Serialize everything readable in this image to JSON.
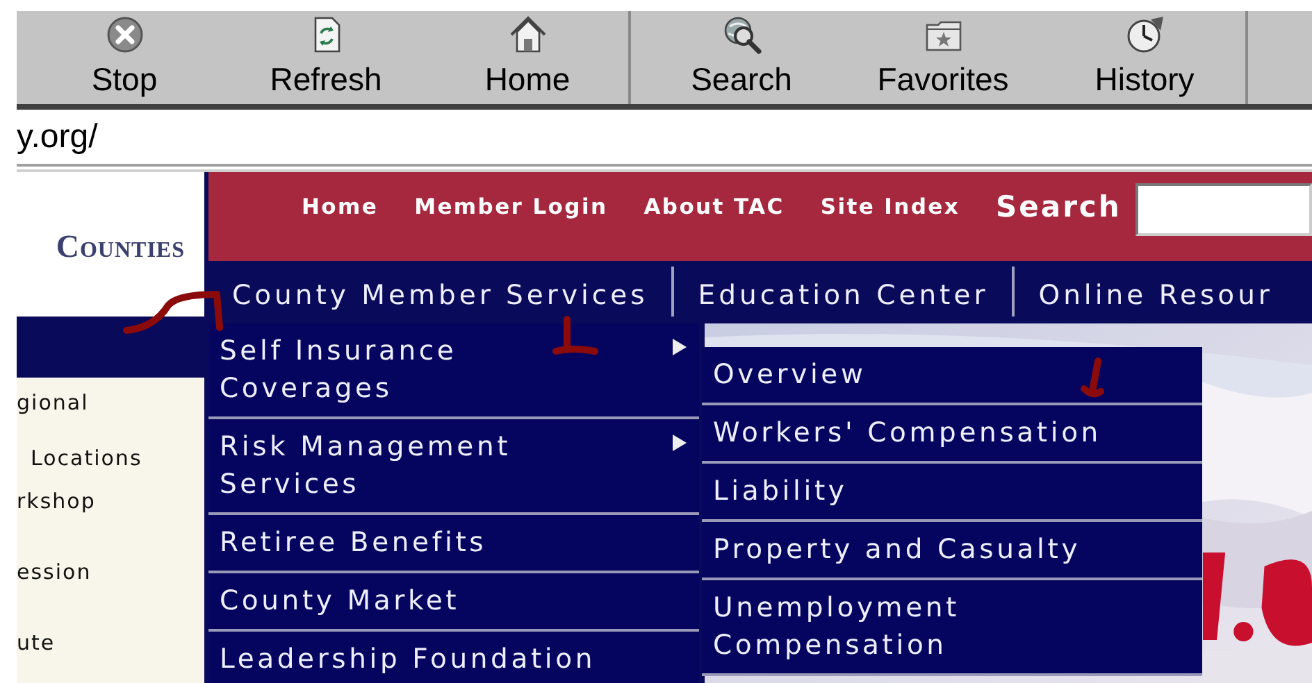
{
  "toolbar": {
    "groups": [
      {
        "buttons": [
          {
            "label": "Stop",
            "kind": "stop"
          },
          {
            "label": "Refresh",
            "kind": "refresh"
          },
          {
            "label": "Home",
            "kind": "home"
          }
        ]
      },
      {
        "buttons": [
          {
            "label": "Search",
            "kind": "search"
          },
          {
            "label": "Favorites",
            "kind": "favorites"
          },
          {
            "label": "History",
            "kind": "history"
          }
        ]
      }
    ]
  },
  "address_bar": {
    "value": "y.org/"
  },
  "sidebar": {
    "logo": "Counties",
    "items": [
      {
        "text": "gional",
        "kind": "plain"
      },
      {
        "text": "Locations",
        "kind": "indented"
      },
      {
        "text": "rkshop",
        "kind": "plain"
      },
      {
        "text": "ession",
        "kind": "plain"
      },
      {
        "text": "ute",
        "kind": "plain"
      }
    ]
  },
  "header": {
    "links": [
      "Home",
      "Member Login",
      "About TAC",
      "Site Index"
    ],
    "search_label": "Search"
  },
  "main_nav": [
    {
      "label": "County Member Services",
      "menu": [
        {
          "label": "Self Insurance Coverages",
          "has_submenu": true,
          "children": [
            {
              "label": "Overview"
            },
            {
              "label": "Workers' Compensation"
            },
            {
              "label": "Liability"
            },
            {
              "label": "Property and Casualty"
            },
            {
              "label": "Unemployment Compensation"
            }
          ]
        },
        {
          "label": "Risk Management Services",
          "has_submenu": true
        },
        {
          "label": "Retiree Benefits",
          "has_submenu": false
        },
        {
          "label": "County Market",
          "has_submenu": false
        },
        {
          "label": "Leadership Foundation",
          "has_submenu": false
        }
      ]
    },
    {
      "label": "Education Center"
    },
    {
      "label": "Online Resour"
    }
  ]
}
